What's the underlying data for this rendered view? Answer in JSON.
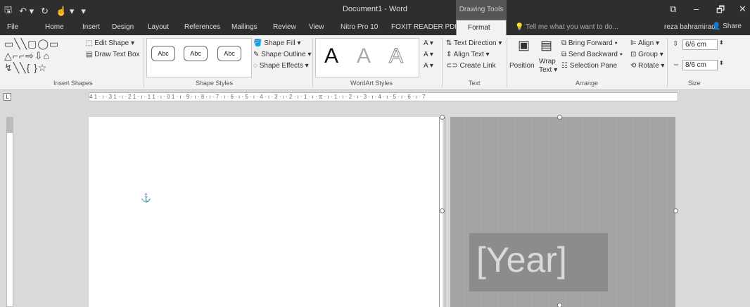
{
  "window": {
    "title": "Document1 - Word",
    "tools_label": "Drawing Tools",
    "controls": {
      "restore": "⧉",
      "minimize": "–",
      "maximize": "🗗",
      "close": "✕"
    }
  },
  "qat": {
    "save": "🖫",
    "undo": "↶ ▾",
    "redo": "↻",
    "touch": "☝ ▾",
    "customize": "▾"
  },
  "tabs": [
    "File",
    "Home",
    "Insert",
    "Design",
    "Layout",
    "References",
    "Mailings",
    "Review",
    "View",
    "Nitro Pro 10",
    "FOXIT READER PDF",
    "Format"
  ],
  "active_tab": "Format",
  "tell_me": "Tell me what you want to do...",
  "user_name": "reza bahramirad",
  "share_label": "Share",
  "ribbon": {
    "insert_shapes": {
      "shape_rows": [
        "▭╲╲▢◯▭",
        "△⌐⌐⇨⇩⌂",
        "↯╲╲{ }☆"
      ],
      "edit_shape": "Edit Shape ▾",
      "draw_text_box": "Draw Text Box",
      "label": "Insert Shapes"
    },
    "shape_styles": {
      "sample": "Abc",
      "shape_fill": "Shape Fill ▾",
      "shape_outline": "Shape Outline ▾",
      "shape_effects": "Shape Effects ▾",
      "label": "Shape Styles"
    },
    "wordart_styles": {
      "sample": "A",
      "label": "WordArt Styles"
    },
    "text": {
      "text_direction": "Text Direction ▾",
      "align_text": "Align Text ▾",
      "create_link": "Create Link",
      "label": "Text"
    },
    "arrange": {
      "position": "Position",
      "wrap_text_1": "Wrap",
      "wrap_text_2": "Text ▾",
      "bring_forward": "Bring Forward ▾",
      "send_backward": "Send Backward ▾",
      "selection_pane": "Selection Pane",
      "align": "Align ▾",
      "group": "Group ▾",
      "rotate": "Rotate ▾",
      "label": "Arrange"
    },
    "size": {
      "height": "6/6 cm",
      "width": "8/6 cm",
      "label": "Size"
    }
  },
  "ruler": {
    "corner": "L",
    "marks": "4 1 · ı · 3 1 · ı · 2 1 · ı · 1 1 · ı · 0 1 · ı · 9 · ı · 8 · ı · 7 · ı · 6 · ı · 5 · ı · 4 · ı · 3 · ı · 2 · ı · 1 · ı · ⧖ · ı · 1 · ı · 2 · ı · 3 · ı · 4 · ı · 5 · ı · 6 · ı · 7"
  },
  "document": {
    "anchor": "⚓",
    "year_placeholder": "[Year]"
  },
  "colors": {
    "titlebar": "#2e2e2e",
    "ribbon": "#f2f2f2",
    "cover": "#a3a3a3",
    "year_box": "#8c8c8c"
  }
}
